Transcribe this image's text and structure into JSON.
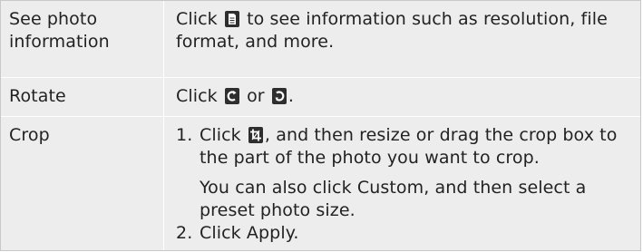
{
  "rows": [
    {
      "label": "See photo information",
      "text_before_icon": "Click",
      "icon": "info-doc-icon",
      "text_after_icon": "to see information such as resolution, file format, and more."
    },
    {
      "label": "Rotate",
      "text_before_icon": "Click",
      "icon_1": "rotate-left-icon",
      "middle": "or",
      "icon_2": "rotate-right-icon",
      "end": "."
    },
    {
      "label": "Crop",
      "steps": [
        {
          "num": "1.",
          "before_icon": "Click",
          "icon": "crop-icon",
          "after_icon": ", and then resize or drag the crop box to the part of the photo you want to crop.",
          "note_before": "You can also click",
          "note_bold": "Custom",
          "note_after": ", and then select a preset photo size."
        },
        {
          "num": "2.",
          "before": "Click",
          "bold": "Apply",
          "after": "."
        }
      ]
    }
  ]
}
